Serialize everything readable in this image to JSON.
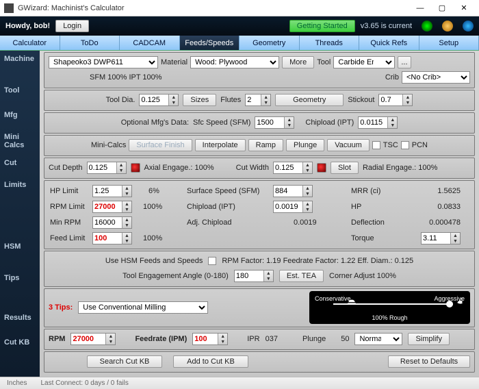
{
  "app": {
    "title": "GWizard: Machinist's Calculator"
  },
  "topbar": {
    "greeting": "Howdy, bob!",
    "login": "Login",
    "getting_started": "Getting Started",
    "version": "v3.65 is current"
  },
  "tabs": [
    "Calculator",
    "ToDo",
    "CADCAM",
    "Feeds/Speeds",
    "Geometry",
    "Threads",
    "Quick Refs",
    "Setup"
  ],
  "side": [
    "Machine",
    "Tool",
    "Mfg",
    "Mini Calcs",
    "Cut",
    "Limits",
    "HSM",
    "Tips",
    "Results",
    "Cut KB"
  ],
  "machine": {
    "profile": "Shapeoko3 DWP611",
    "material_lbl": "Material",
    "material": "Wood: Plywood",
    "more": "More",
    "tool_lbl": "Tool",
    "tool": "Carbide Endmill",
    "sfm": "SFM 100%  IPT 100%",
    "crib_lbl": "Crib",
    "crib": "<No Crib>"
  },
  "tool": {
    "dia_lbl": "Tool Dia.",
    "dia": "0.125",
    "sizes": "Sizes",
    "flutes_lbl": "Flutes",
    "flutes": "2",
    "geometry": "Geometry",
    "stickout_lbl": "Stickout",
    "stickout": "0.7"
  },
  "mfg": {
    "prefix": "Optional Mfg's Data:",
    "sfc_lbl": "Sfc Speed (SFM)",
    "sfc": "1500",
    "chip_lbl": "Chipload (IPT)",
    "chip": "0.0115"
  },
  "mini": {
    "lbl": "Mini-Calcs",
    "surface": "Surface Finish",
    "interpolate": "Interpolate",
    "ramp": "Ramp",
    "plunge": "Plunge",
    "vacuum": "Vacuum",
    "tsc": "TSC",
    "pcn": "PCN"
  },
  "cut": {
    "depth_lbl": "Cut Depth",
    "depth": "0.125",
    "axial": "Axial Engage.: 100%",
    "width_lbl": "Cut Width",
    "width": "0.125",
    "slot": "Slot",
    "radial": "Radial Engage.: 100%"
  },
  "limits": {
    "hp_lbl": "HP Limit",
    "hp": "1.25",
    "hp_pct": "6%",
    "rpm_lbl": "RPM Limit",
    "rpm": "27000",
    "rpm_pct": "100%",
    "min_lbl": "Min RPM",
    "min": "16000",
    "feed_lbl": "Feed Limit",
    "feed": "100",
    "feed_pct": "100%",
    "ss_lbl": "Surface Speed (SFM)",
    "ss": "884",
    "cl_lbl": "Chipload (IPT)",
    "cl": "0.0019",
    "adj_lbl": "Adj. Chipload",
    "adj": "0.0019",
    "mrr_lbl": "MRR (ci)",
    "mrr": "1.5625",
    "hp2_lbl": "HP",
    "hp2": "0.0833",
    "def_lbl": "Deflection",
    "def": "0.000478",
    "tq_lbl": "Torque",
    "tq": "3.11"
  },
  "hsm": {
    "use": "Use HSM Feeds and Speeds",
    "factors": "RPM Factor: 1.19  Feedrate Factor: 1.22  Eff. Diam.: 0.125",
    "tea_lbl": "Tool Engagement Angle (0-180)",
    "tea": "180",
    "est": "Est. TEA",
    "corner": "Corner Adjust 100%"
  },
  "tips": {
    "count": "3 Tips:",
    "sel": "Use Conventional Milling",
    "cons": "Conservative",
    "agg": "Aggressive",
    "cap": "100% Rough"
  },
  "results": {
    "rpm_lbl": "RPM",
    "rpm": "27000",
    "feed_lbl": "Feedrate (IPM)",
    "feed": "100",
    "ipr_lbl": "IPR",
    "ipr": "037",
    "plunge_lbl": "Plunge",
    "plunge": "50",
    "mode": "Normal",
    "simplify": "Simplify"
  },
  "kb": {
    "search": "Search Cut KB",
    "add": "Add to Cut KB",
    "reset": "Reset to Defaults"
  },
  "status": {
    "units": "Inches",
    "conn": "Last Connect: 0 days / 0 fails"
  }
}
